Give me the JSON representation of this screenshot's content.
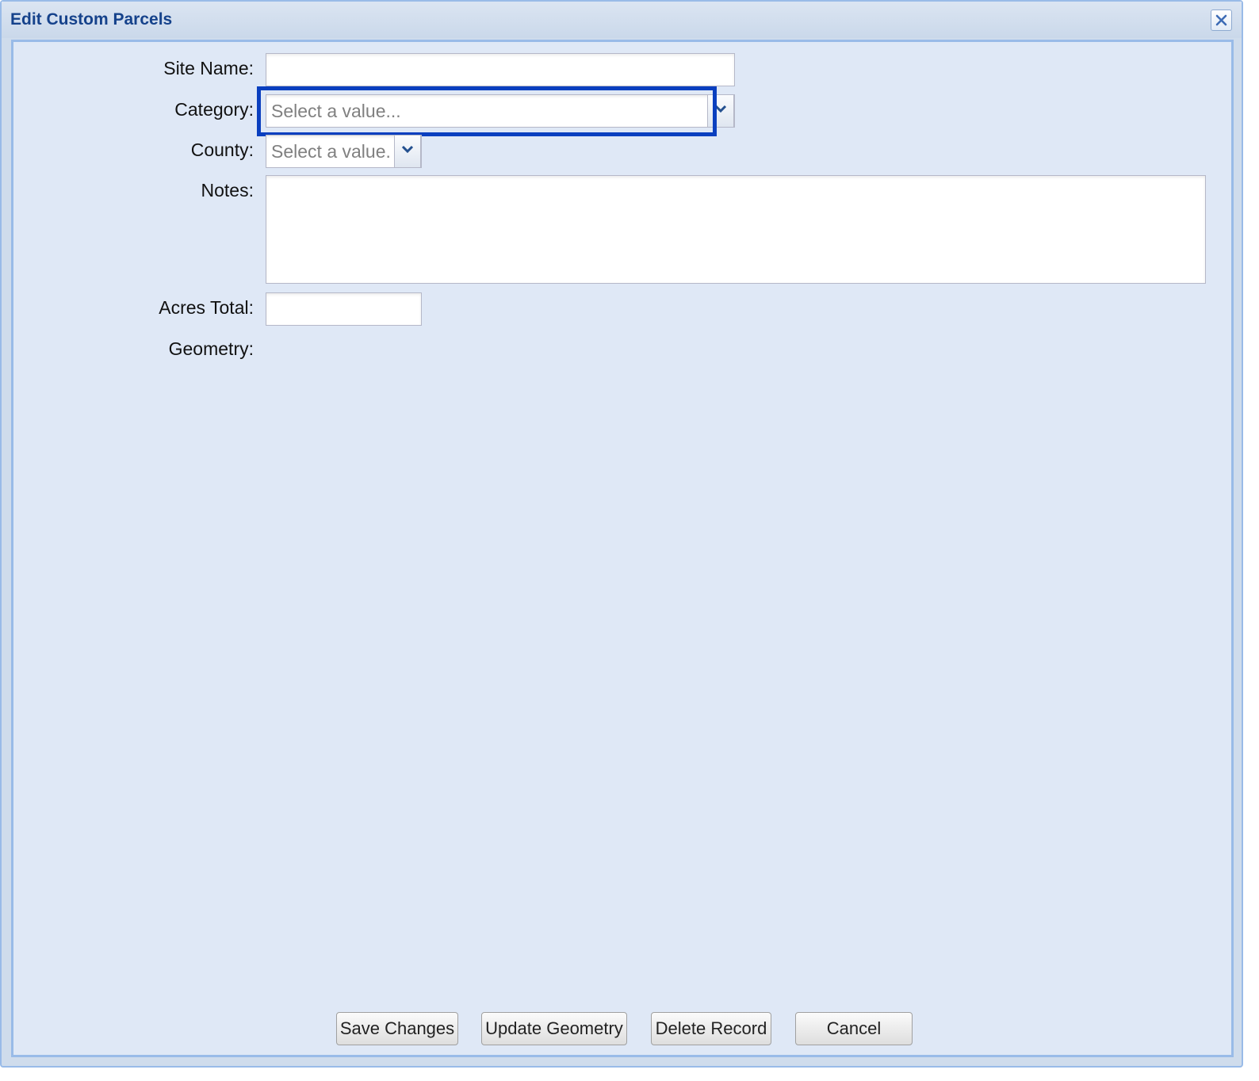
{
  "dialog": {
    "title": "Edit Custom Parcels",
    "close_icon": "close-icon"
  },
  "form": {
    "site_name": {
      "label": "Site Name:",
      "value": ""
    },
    "category": {
      "label": "Category:",
      "placeholder": "Select a value...",
      "trigger_icon": "chevron-down-icon"
    },
    "county": {
      "label": "County:",
      "placeholder": "Select a value...",
      "trigger_icon": "chevron-down-icon"
    },
    "notes": {
      "label": "Notes:",
      "value": ""
    },
    "acres_total": {
      "label": "Acres Total:",
      "value": ""
    },
    "geometry": {
      "label": "Geometry:"
    }
  },
  "buttons": {
    "save": "Save Changes",
    "update_geometry": "Update Geometry",
    "delete": "Delete Record",
    "cancel": "Cancel"
  },
  "colors": {
    "title": "#15428b",
    "focus": "#0a3fbf",
    "panel_bg": "#dfe8f6",
    "border": "#99bbe8"
  }
}
